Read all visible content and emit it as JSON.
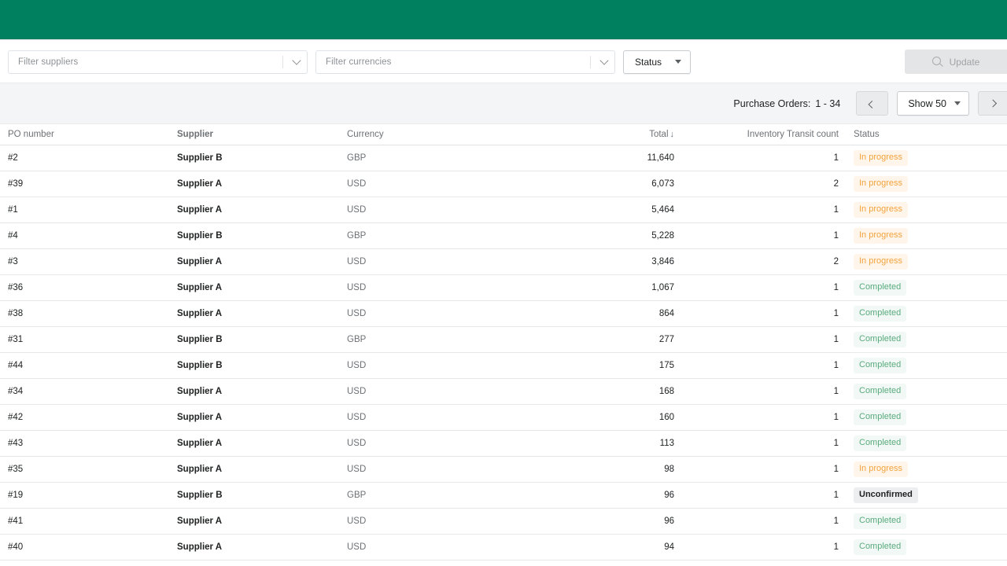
{
  "brand": {
    "accent_color": "#00805E"
  },
  "toolbar": {
    "suppliers_filter": {
      "placeholder": "Filter suppliers",
      "value": ""
    },
    "currencies_filter": {
      "placeholder": "Filter currencies",
      "value": ""
    },
    "status_dropdown": {
      "label": "Status"
    },
    "update_button": {
      "label": "Update",
      "icon": "search-icon",
      "disabled": true
    }
  },
  "pagination": {
    "label": "Purchase Orders:",
    "range": "1 - 34",
    "prev_label": "‹",
    "next_label": "›",
    "page_size_label": "Show 50"
  },
  "table": {
    "columns": [
      {
        "key": "po",
        "label": "PO number"
      },
      {
        "key": "supplier",
        "label": "Supplier"
      },
      {
        "key": "currency",
        "label": "Currency"
      },
      {
        "key": "total",
        "label": "Total",
        "sort": "desc",
        "sort_glyph": "↓"
      },
      {
        "key": "inventory_transit",
        "label": "Inventory Transit count"
      },
      {
        "key": "status",
        "label": "Status"
      }
    ],
    "rows": [
      {
        "po": "#2",
        "supplier": "Supplier B",
        "currency": "GBP",
        "total": "11,640",
        "inventory_transit": "1",
        "status": "In progress",
        "status_type": "inprogress"
      },
      {
        "po": "#39",
        "supplier": "Supplier A",
        "currency": "USD",
        "total": "6,073",
        "inventory_transit": "2",
        "status": "In progress",
        "status_type": "inprogress"
      },
      {
        "po": "#1",
        "supplier": "Supplier A",
        "currency": "USD",
        "total": "5,464",
        "inventory_transit": "1",
        "status": "In progress",
        "status_type": "inprogress"
      },
      {
        "po": "#4",
        "supplier": "Supplier B",
        "currency": "GBP",
        "total": "5,228",
        "inventory_transit": "1",
        "status": "In progress",
        "status_type": "inprogress"
      },
      {
        "po": "#3",
        "supplier": "Supplier A",
        "currency": "USD",
        "total": "3,846",
        "inventory_transit": "2",
        "status": "In progress",
        "status_type": "inprogress"
      },
      {
        "po": "#36",
        "supplier": "Supplier A",
        "currency": "USD",
        "total": "1,067",
        "inventory_transit": "1",
        "status": "Completed",
        "status_type": "completed"
      },
      {
        "po": "#38",
        "supplier": "Supplier A",
        "currency": "USD",
        "total": "864",
        "inventory_transit": "1",
        "status": "Completed",
        "status_type": "completed"
      },
      {
        "po": "#31",
        "supplier": "Supplier B",
        "currency": "GBP",
        "total": "277",
        "inventory_transit": "1",
        "status": "Completed",
        "status_type": "completed"
      },
      {
        "po": "#44",
        "supplier": "Supplier B",
        "currency": "USD",
        "total": "175",
        "inventory_transit": "1",
        "status": "Completed",
        "status_type": "completed"
      },
      {
        "po": "#34",
        "supplier": "Supplier A",
        "currency": "USD",
        "total": "168",
        "inventory_transit": "1",
        "status": "Completed",
        "status_type": "completed"
      },
      {
        "po": "#42",
        "supplier": "Supplier A",
        "currency": "USD",
        "total": "160",
        "inventory_transit": "1",
        "status": "Completed",
        "status_type": "completed"
      },
      {
        "po": "#43",
        "supplier": "Supplier A",
        "currency": "USD",
        "total": "113",
        "inventory_transit": "1",
        "status": "Completed",
        "status_type": "completed"
      },
      {
        "po": "#35",
        "supplier": "Supplier A",
        "currency": "USD",
        "total": "98",
        "inventory_transit": "1",
        "status": "In progress",
        "status_type": "inprogress"
      },
      {
        "po": "#19",
        "supplier": "Supplier B",
        "currency": "GBP",
        "total": "96",
        "inventory_transit": "1",
        "status": "Unconfirmed",
        "status_type": "unconfirmed"
      },
      {
        "po": "#41",
        "supplier": "Supplier A",
        "currency": "USD",
        "total": "96",
        "inventory_transit": "1",
        "status": "Completed",
        "status_type": "completed"
      },
      {
        "po": "#40",
        "supplier": "Supplier A",
        "currency": "USD",
        "total": "94",
        "inventory_transit": "1",
        "status": "Completed",
        "status_type": "completed"
      }
    ]
  }
}
